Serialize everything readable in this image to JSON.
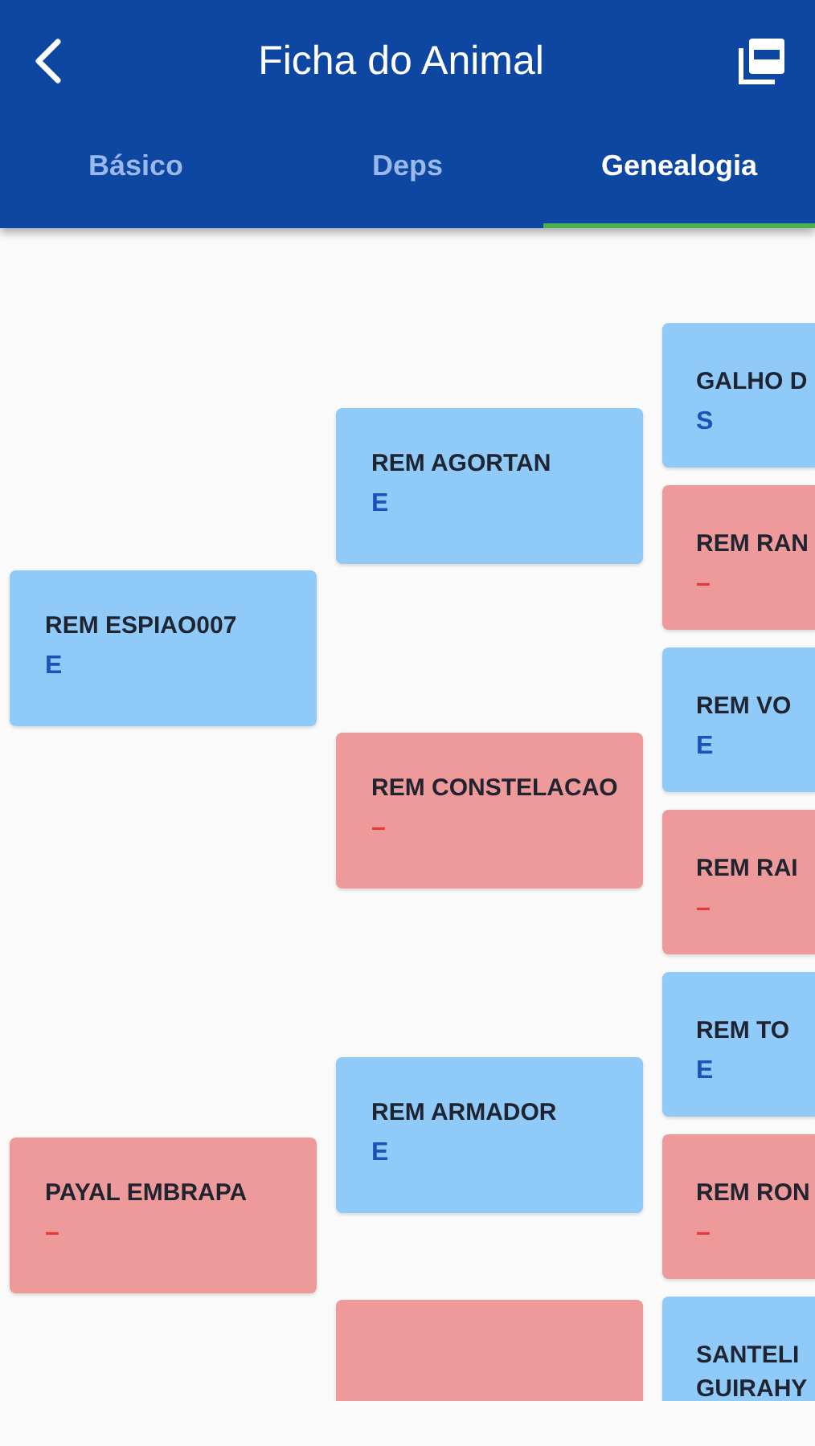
{
  "app_bar": {
    "title": "Ficha do Animal"
  },
  "tabs": [
    {
      "label": "Básico",
      "selected": false
    },
    {
      "label": "Deps",
      "selected": false
    },
    {
      "label": "Genealogia",
      "selected": true
    }
  ],
  "pedigree": [
    {
      "name": "REM ESPIAO007",
      "grade": "E",
      "kind": "male",
      "children": [
        {
          "name": "REM AGORTAN",
          "grade": "E",
          "kind": "male",
          "children": [
            {
              "name": "GALHO D",
              "grade": "S",
              "kind": "male"
            },
            {
              "name": "REM RAN",
              "grade": "–",
              "kind": "female"
            }
          ]
        },
        {
          "name": "REM CONSTELACAO",
          "grade": "–",
          "kind": "female",
          "children": [
            {
              "name": "REM VO",
              "grade": "E",
              "kind": "male"
            },
            {
              "name": "REM RAI",
              "grade": "–",
              "kind": "female"
            }
          ]
        }
      ]
    },
    {
      "name": "PAYAL EMBRAPA",
      "grade": "–",
      "kind": "female",
      "children": [
        {
          "name": "REM ARMADOR",
          "grade": "E",
          "kind": "male",
          "children": [
            {
              "name": "REM TO",
              "grade": "E",
              "kind": "male"
            },
            {
              "name": "REM RON",
              "grade": "–",
              "kind": "female"
            }
          ]
        },
        {
          "kind": "female",
          "children": [
            {
              "name": "SANTELI GUIRAHY",
              "kind": "male"
            }
          ]
        }
      ]
    }
  ]
}
